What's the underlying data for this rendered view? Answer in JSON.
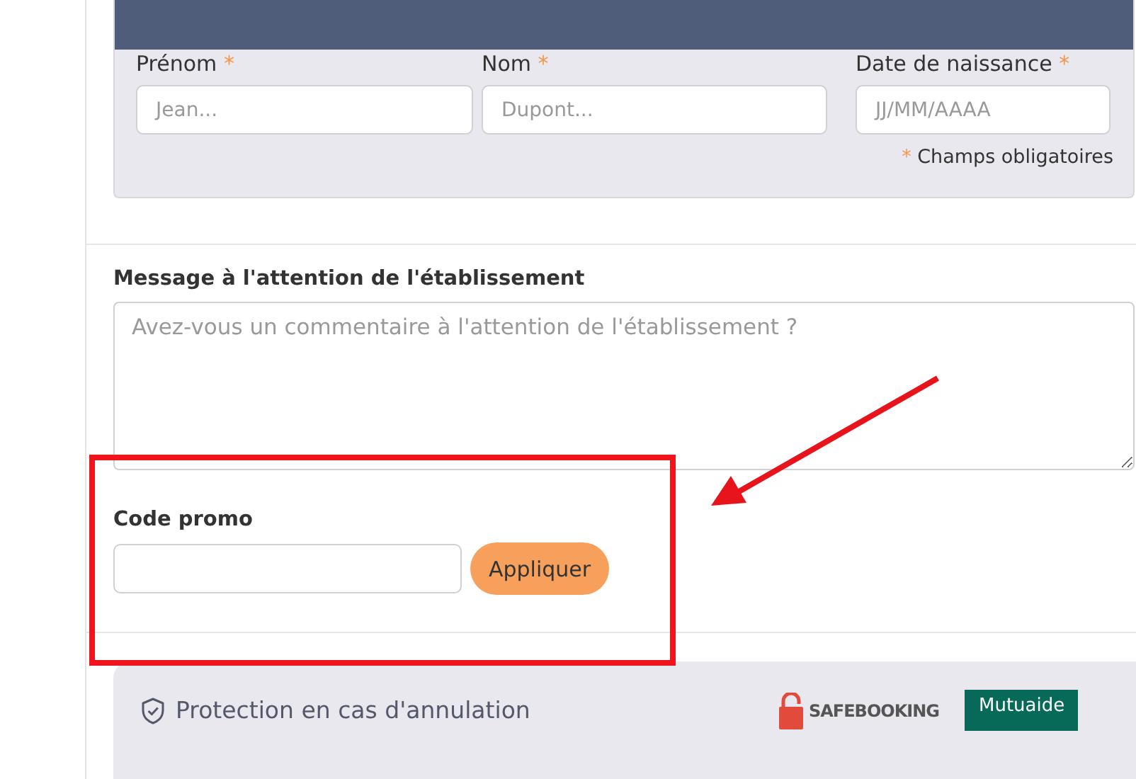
{
  "identity_form": {
    "fields": [
      {
        "label": "Prénom",
        "required_mark": "*",
        "placeholder": "Jean..."
      },
      {
        "label": "Nom",
        "required_mark": "*",
        "placeholder": "Dupont..."
      },
      {
        "label": "Date de naissance",
        "required_mark": "*",
        "placeholder": "JJ/MM/AAAA"
      }
    ],
    "required_note": {
      "mark": "*",
      "text": "Champs obligatoires"
    }
  },
  "message": {
    "label": "Message à l'attention de l'établissement",
    "placeholder": "Avez-vous un commentaire à l'attention de l'établissement ?"
  },
  "promo": {
    "label": "Code promo",
    "button": "Appliquer"
  },
  "protection": {
    "title": "Protection en cas d'annulation",
    "logos": [
      {
        "kind": "safebooking",
        "text": "SAFEBOOKING"
      },
      {
        "kind": "mutuaide",
        "text": "Mutuaide"
      }
    ]
  }
}
